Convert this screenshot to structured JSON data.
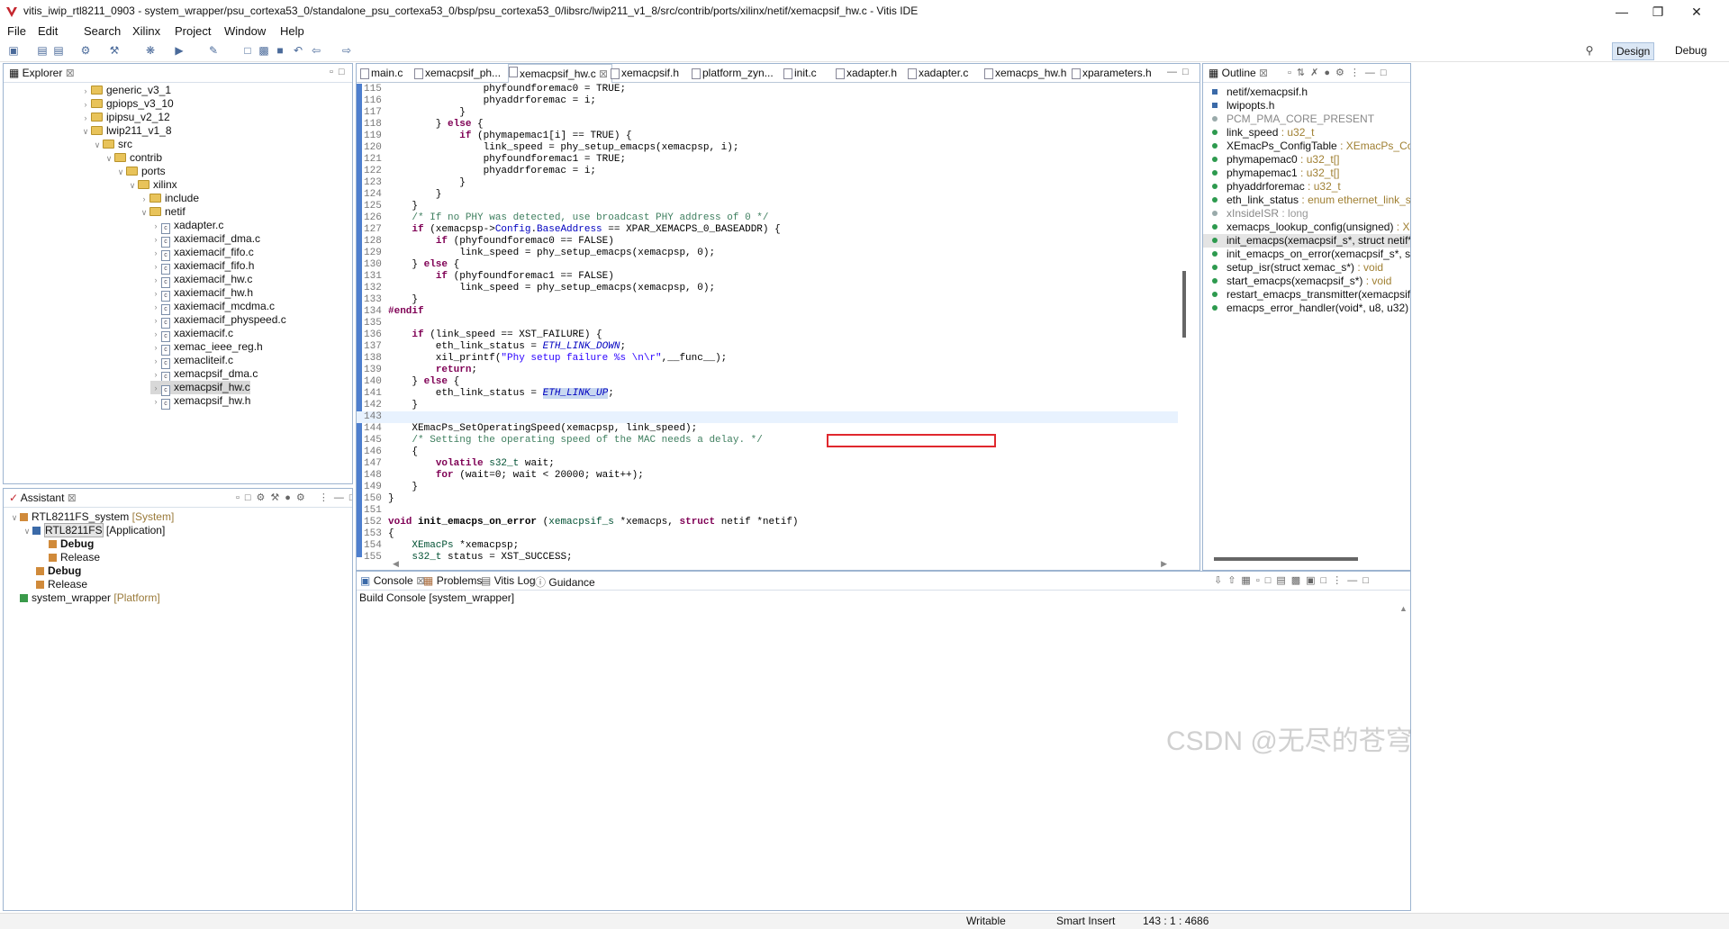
{
  "window": {
    "title": "vitis_iwip_rtl8211_0903 - system_wrapper/psu_cortexa53_0/standalone_psu_cortexa53_0/bsp/psu_cortexa53_0/libsrc/lwip211_v1_8/src/contrib/ports/xilinx/netif/xemacpsif_hw.c - Vitis IDE"
  },
  "menu": [
    "File",
    "Edit",
    "Search",
    "Xilinx",
    "Project",
    "Window",
    "Help"
  ],
  "perspectives": {
    "design": "Design",
    "debug": "Debug"
  },
  "explorer": {
    "tab": "Explorer",
    "items": [
      {
        "label": "generic_v3_1",
        "kind": "folder",
        "arrow": ">"
      },
      {
        "label": "gpiops_v3_10",
        "kind": "folder",
        "arrow": ">"
      },
      {
        "label": "ipipsu_v2_12",
        "kind": "folder",
        "arrow": ">"
      },
      {
        "label": "lwip211_v1_8",
        "kind": "folder",
        "arrow": "v"
      },
      {
        "label": "src",
        "kind": "folder",
        "arrow": "v"
      },
      {
        "label": "contrib",
        "kind": "folder",
        "arrow": "v"
      },
      {
        "label": "ports",
        "kind": "folder",
        "arrow": "v"
      },
      {
        "label": "xilinx",
        "kind": "folder",
        "arrow": "v"
      },
      {
        "label": "include",
        "kind": "folder",
        "arrow": ">"
      },
      {
        "label": "netif",
        "kind": "folder",
        "arrow": "v"
      },
      {
        "label": "xadapter.c",
        "kind": "file",
        "arrow": ">"
      },
      {
        "label": "xaxiemacif_dma.c",
        "kind": "file",
        "arrow": ">"
      },
      {
        "label": "xaxiemacif_fifo.c",
        "kind": "file",
        "arrow": ">"
      },
      {
        "label": "xaxiemacif_fifo.h",
        "kind": "file",
        "arrow": ">"
      },
      {
        "label": "xaxiemacif_hw.c",
        "kind": "file",
        "arrow": ">"
      },
      {
        "label": "xaxiemacif_hw.h",
        "kind": "file",
        "arrow": ">"
      },
      {
        "label": "xaxiemacif_mcdma.c",
        "kind": "file",
        "arrow": ">"
      },
      {
        "label": "xaxiemacif_physpeed.c",
        "kind": "file",
        "arrow": ">"
      },
      {
        "label": "xaxiemacif.c",
        "kind": "file",
        "arrow": ">"
      },
      {
        "label": "xemac_ieee_reg.h",
        "kind": "file",
        "arrow": ">"
      },
      {
        "label": "xemacliteif.c",
        "kind": "file",
        "arrow": ">"
      },
      {
        "label": "xemacpsif_dma.c",
        "kind": "file",
        "arrow": ">"
      },
      {
        "label": "xemacpsif_hw.c",
        "kind": "file",
        "arrow": ">"
      },
      {
        "label": "xemacpsif_hw.h",
        "kind": "file",
        "arrow": ">"
      }
    ]
  },
  "assistant": {
    "tab": "Assistant",
    "items": [
      {
        "label": "RTL8211FS_system",
        "tag": "[System]"
      },
      {
        "label": "RTL8211FS",
        "tag": "[Application]"
      },
      {
        "label": "Debug",
        "tag": ""
      },
      {
        "label": "Release",
        "tag": ""
      },
      {
        "label": "Debug",
        "tag": ""
      },
      {
        "label": "Release",
        "tag": ""
      },
      {
        "label": "system_wrapper",
        "tag": "[Platform]"
      }
    ]
  },
  "editor": {
    "tabs": [
      "main.c",
      "xemacpsif_ph...",
      "xemacpsif_hw.c",
      "xemacpsif.h",
      "platform_zyn...",
      "init.c",
      "xadapter.h",
      "xadapter.c",
      "xemacps_hw.h",
      "xparameters.h"
    ],
    "lines": [
      {
        "n": "115",
        "t": "                phyfoundforemac0 = TRUE;"
      },
      {
        "n": "116",
        "t": "                phyaddrforemac = i;"
      },
      {
        "n": "117",
        "t": "            }"
      },
      {
        "n": "118",
        "t": "        } else {"
      },
      {
        "n": "119",
        "t": "            if (phymapemac1[i] == TRUE) {"
      },
      {
        "n": "120",
        "t": "                link_speed = phy_setup_emacps(xemacpsp, i);"
      },
      {
        "n": "121",
        "t": "                phyfoundforemac1 = TRUE;"
      },
      {
        "n": "122",
        "t": "                phyaddrforemac = i;"
      },
      {
        "n": "123",
        "t": "            }"
      },
      {
        "n": "124",
        "t": "        }"
      },
      {
        "n": "125",
        "t": "    }"
      },
      {
        "n": "126",
        "t": "    /* If no PHY was detected, use broadcast PHY address of 0 */"
      },
      {
        "n": "127",
        "t": "    if (xemacpsp->Config.BaseAddress == XPAR_XEMACPS_0_BASEADDR) {"
      },
      {
        "n": "128",
        "t": "        if (phyfoundforemac0 == FALSE)"
      },
      {
        "n": "129",
        "t": "            link_speed = phy_setup_emacps(xemacpsp, 0);"
      },
      {
        "n": "130",
        "t": "    } else {"
      },
      {
        "n": "131",
        "t": "        if (phyfoundforemac1 == FALSE)"
      },
      {
        "n": "132",
        "t": "            link_speed = phy_setup_emacps(xemacpsp, 0);"
      },
      {
        "n": "133",
        "t": "    }"
      },
      {
        "n": "134",
        "t": "#endif"
      },
      {
        "n": "135",
        "t": ""
      },
      {
        "n": "136",
        "t": "    if (link_speed == XST_FAILURE) {"
      },
      {
        "n": "137",
        "t": "        eth_link_status = ETH_LINK_DOWN;"
      },
      {
        "n": "138",
        "t": "        xil_printf(\"Phy setup failure %s \\n\\r\",__func__);"
      },
      {
        "n": "139",
        "t": "        return;"
      },
      {
        "n": "140",
        "t": "    } else {"
      },
      {
        "n": "141",
        "t": "        eth_link_status = ETH_LINK_UP;"
      },
      {
        "n": "142",
        "t": "    }"
      },
      {
        "n": "143",
        "t": ""
      },
      {
        "n": "144",
        "t": "    XEmacPs_SetOperatingSpeed(xemacpsp, link_speed);"
      },
      {
        "n": "145",
        "t": "    /* Setting the operating speed of the MAC needs a delay. */"
      },
      {
        "n": "146",
        "t": "    {"
      },
      {
        "n": "147",
        "t": "        volatile s32_t wait;"
      },
      {
        "n": "148",
        "t": "        for (wait=0; wait < 20000; wait++);"
      },
      {
        "n": "149",
        "t": "    }"
      },
      {
        "n": "150",
        "t": "}"
      },
      {
        "n": "151",
        "t": ""
      },
      {
        "n": "152",
        "t": "void init_emacps_on_error (xemacpsif_s *xemacps, struct netif *netif)"
      },
      {
        "n": "153",
        "t": "{"
      },
      {
        "n": "154",
        "t": "    XEmacPs *xemacpsp;"
      },
      {
        "n": "155",
        "t": "    s32_t status = XST_SUCCESS;"
      }
    ]
  },
  "outline": {
    "tab": "Outline",
    "items": [
      {
        "label": "netif/xemacpsif.h",
        "type": ""
      },
      {
        "label": "lwipopts.h",
        "type": ""
      },
      {
        "label": "PCM_PMA_CORE_PRESENT",
        "type": ""
      },
      {
        "label": "link_speed",
        "type": " : u32_t"
      },
      {
        "label": "XEmacPs_ConfigTable",
        "type": " : XEmacPs_Config[]"
      },
      {
        "label": "phymapemac0",
        "type": " : u32_t[]"
      },
      {
        "label": "phymapemac1",
        "type": " : u32_t[]"
      },
      {
        "label": "phyaddrforemac",
        "type": " : u32_t"
      },
      {
        "label": "eth_link_status",
        "type": " : enum ethernet_link_statu"
      },
      {
        "label": "xInsideISR",
        "type": " : long"
      },
      {
        "label": "xemacps_lookup_config(unsigned)",
        "type": " : XEma"
      },
      {
        "label": "init_emacps(xemacpsif_s*, struct netif*)",
        "type": " : v"
      },
      {
        "label": "init_emacps_on_error(xemacpsif_s*, struc",
        "type": ""
      },
      {
        "label": "setup_isr(struct xemac_s*)",
        "type": " : void"
      },
      {
        "label": "start_emacps(xemacpsif_s*)",
        "type": " : void"
      },
      {
        "label": "restart_emacps_transmitter(xemacpsif_s*",
        "type": ""
      },
      {
        "label": "emacps_error_handler(void*, u8, u32)",
        "type": " : vo"
      }
    ]
  },
  "console": {
    "tabs": [
      "Console",
      "Problems",
      "Vitis Log",
      "Guidance"
    ],
    "header": "Build Console [system_wrapper]"
  },
  "status": {
    "writable": "Writable",
    "insert": "Smart Insert",
    "position": "143 : 1 : 4686"
  },
  "watermark": "CSDN @无尽的苍穹"
}
